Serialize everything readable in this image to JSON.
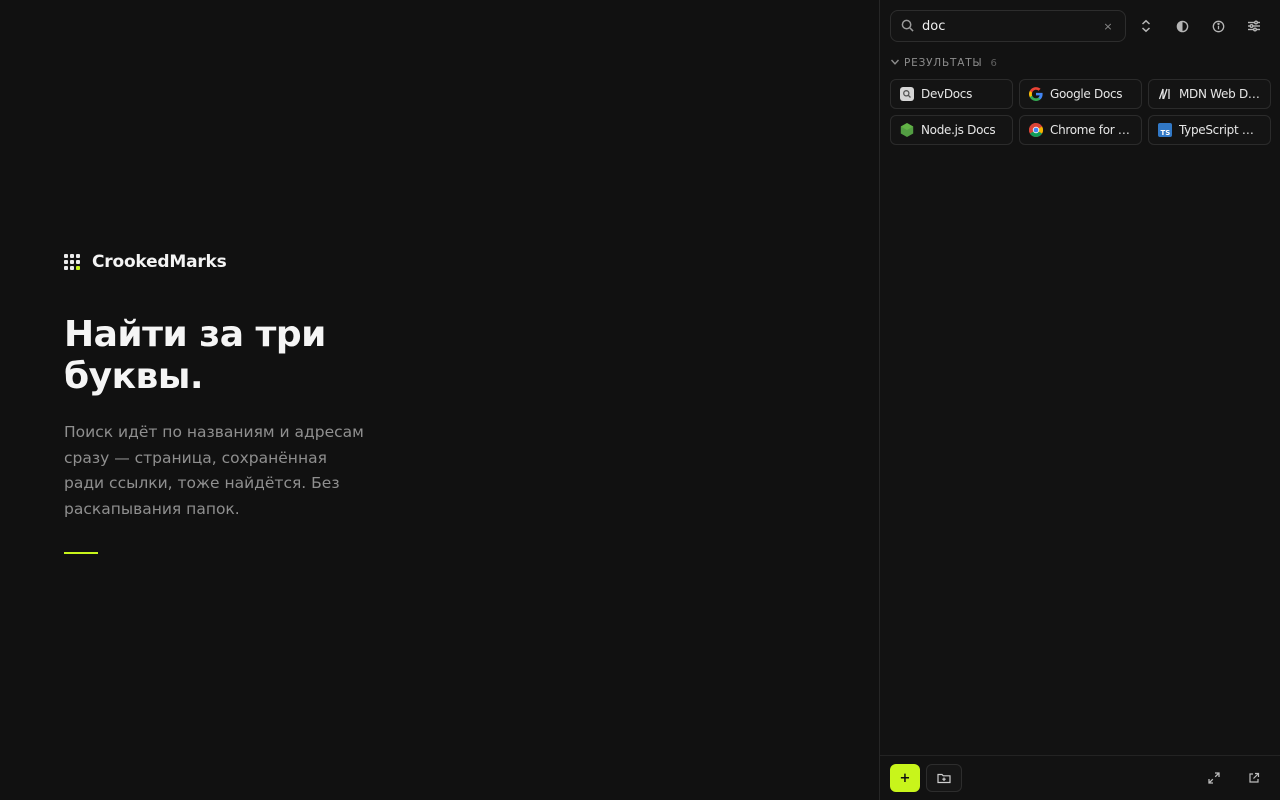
{
  "brand": {
    "name": "CrookedMarks"
  },
  "hero": {
    "title": "Найти за три\nбуквы.",
    "description": "Поиск идёт по названиям и адресам сразу — страница, сохранённая ради ссылки, тоже найдётся. Без раскапывания папок.",
    "accent_color": "#c8f51b"
  },
  "search": {
    "value": "doc",
    "clear_label": "×"
  },
  "toolbar": {
    "buttons": [
      "sort-icon",
      "theme-contrast-icon",
      "info-icon",
      "settings-sliders-icon"
    ]
  },
  "results": {
    "label": "Результаты",
    "count": "6",
    "items": [
      {
        "label": "DevDocs",
        "icon": "devdocs-icon"
      },
      {
        "label": "Google Docs",
        "icon": "google-icon"
      },
      {
        "label": "MDN Web Docs",
        "icon": "mdn-icon"
      },
      {
        "label": "Node.js Docs",
        "icon": "nodejs-icon"
      },
      {
        "label": "Chrome for De...",
        "icon": "chrome-icon"
      },
      {
        "label": "TypeScript Ha...",
        "icon": "typescript-icon"
      }
    ]
  },
  "bottom": {
    "add_label": "+",
    "actions": [
      "new-folder-icon",
      "expand-icon",
      "open-external-icon"
    ]
  }
}
